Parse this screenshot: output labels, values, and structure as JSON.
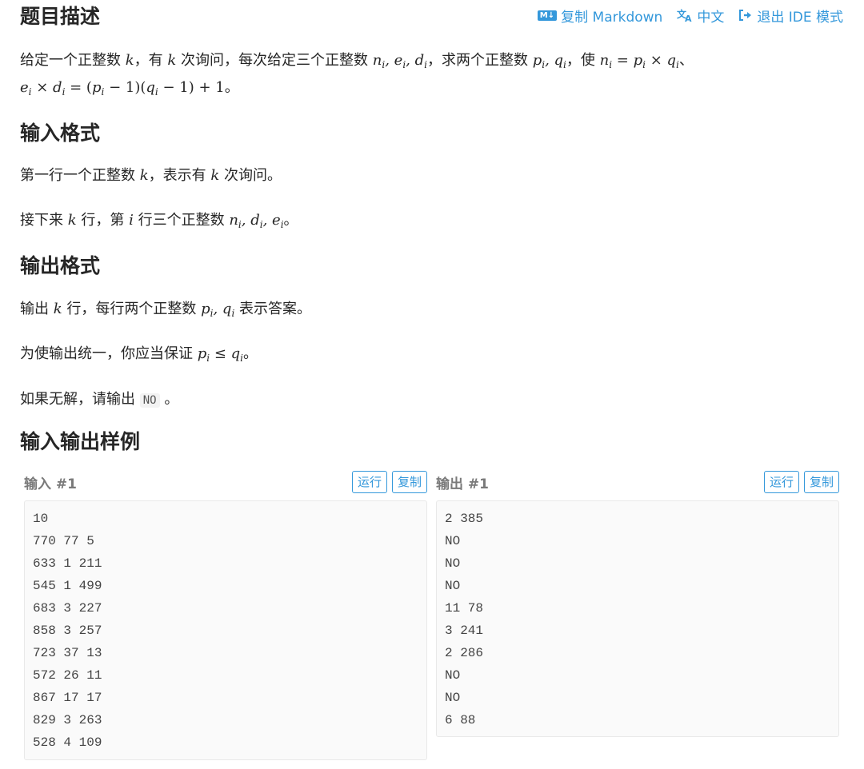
{
  "toolbar": {
    "copy_markdown": "复制 Markdown",
    "md_badge": "M↓",
    "language": "中文",
    "language_icon": "文A",
    "exit_ide": "退出 IDE 模式"
  },
  "description": {
    "heading": "题目描述",
    "line1": {
      "t1": "给定一个正整数 ",
      "t2": "，有 ",
      "t3": " 次询问，每次给定三个正整数 ",
      "t4": "，求两个正整数 ",
      "t5": "，使 ",
      "t6": "、"
    },
    "line2_tail": "。"
  },
  "input_format": {
    "heading": "输入格式",
    "p1": {
      "a": "第一行一个正整数 ",
      "b": "，表示有 ",
      "c": " 次询问。"
    },
    "p2": {
      "a": "接下来 ",
      "b": " 行，第 ",
      "c": " 行三个正整数 ",
      "d": "。"
    }
  },
  "output_format": {
    "heading": "输出格式",
    "p1": {
      "a": "输出 ",
      "b": " 行，每行两个正整数 ",
      "c": " 表示答案。"
    },
    "p2": {
      "a": "为使输出统一，你应当保证 ",
      "b": "。"
    },
    "p3": {
      "a": "如果无解，请输出 ",
      "code": "NO",
      "b": " 。"
    }
  },
  "samples": {
    "heading": "输入输出样例",
    "input_title": "输入 #1",
    "output_title": "输出 #1",
    "run_label": "运行",
    "copy_label": "复制",
    "input_lines": [
      "10",
      "770 77 5",
      "633 1 211",
      "545 1 499",
      "683 3 227",
      "858 3 257",
      "723 37 13",
      "572 26 11",
      "867 17 17",
      "829 3 263",
      "528 4 109"
    ],
    "output_lines": [
      "2 385",
      "NO",
      "NO",
      "NO",
      "11 78",
      "3 241",
      "2 286",
      "NO",
      "NO",
      "6 88"
    ]
  },
  "colors": {
    "accent": "#3498db",
    "text": "#262626",
    "code_bg": "#fafafa"
  }
}
